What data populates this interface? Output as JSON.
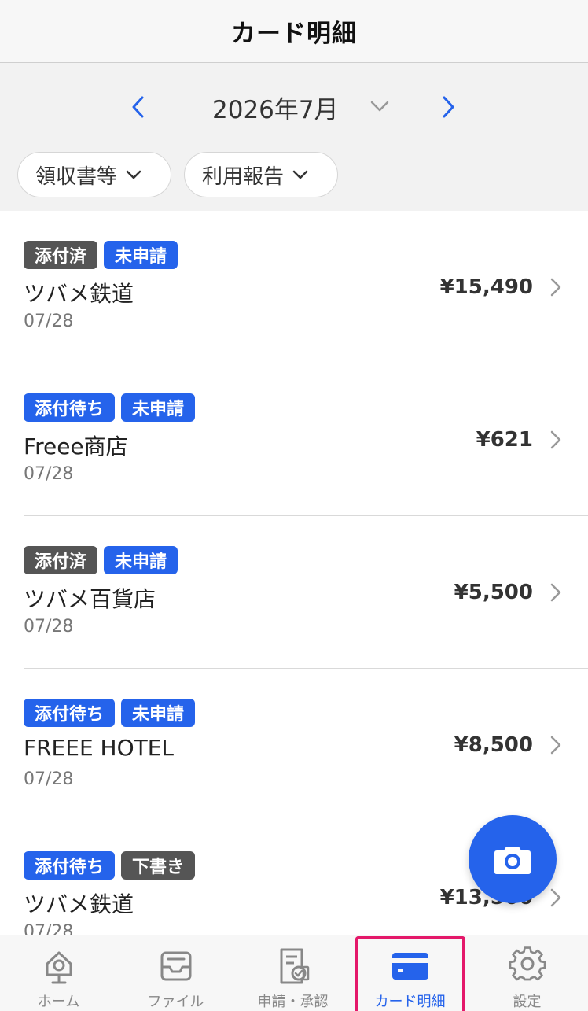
{
  "header": {
    "title": "カード明細"
  },
  "month_nav": {
    "label": "2026年7月",
    "prev_icon": "chevron-left-icon",
    "next_icon": "chevron-right-icon",
    "accent": "#2563eb"
  },
  "filters": [
    {
      "label": "領収書等"
    },
    {
      "label": "利用報告"
    }
  ],
  "transactions": [
    {
      "badges": [
        {
          "label": "添付済",
          "style": "dark"
        },
        {
          "label": "未申請",
          "style": "blue"
        }
      ],
      "merchant": "ツバメ鉄道",
      "date": "07/28",
      "amount": "¥15,490"
    },
    {
      "badges": [
        {
          "label": "添付待ち",
          "style": "blue"
        },
        {
          "label": "未申請",
          "style": "blue"
        }
      ],
      "merchant": "Freee商店",
      "date": "07/28",
      "amount": "¥621"
    },
    {
      "badges": [
        {
          "label": "添付済",
          "style": "dark"
        },
        {
          "label": "未申請",
          "style": "blue"
        }
      ],
      "merchant": "ツバメ百貨店",
      "date": "07/28",
      "amount": "¥5,500"
    },
    {
      "badges": [
        {
          "label": "添付待ち",
          "style": "blue"
        },
        {
          "label": "未申請",
          "style": "blue"
        }
      ],
      "merchant": "FREEE HOTEL",
      "date": "07/28",
      "amount": "¥8,500"
    },
    {
      "badges": [
        {
          "label": "添付待ち",
          "style": "blue"
        },
        {
          "label": "下書き",
          "style": "dark"
        }
      ],
      "merchant": "ツバメ鉄道",
      "date": "07/28",
      "amount": "¥13,500"
    }
  ],
  "fab": {
    "icon": "camera-icon",
    "color": "#2563eb"
  },
  "tabbar": {
    "items": [
      {
        "label": "ホーム",
        "icon": "home-icon"
      },
      {
        "label": "ファイル",
        "icon": "inbox-icon"
      },
      {
        "label": "申請・承認",
        "icon": "document-check-icon"
      },
      {
        "label": "カード明細",
        "icon": "credit-card-icon",
        "active": true
      },
      {
        "label": "設定",
        "icon": "gear-icon"
      }
    ]
  }
}
